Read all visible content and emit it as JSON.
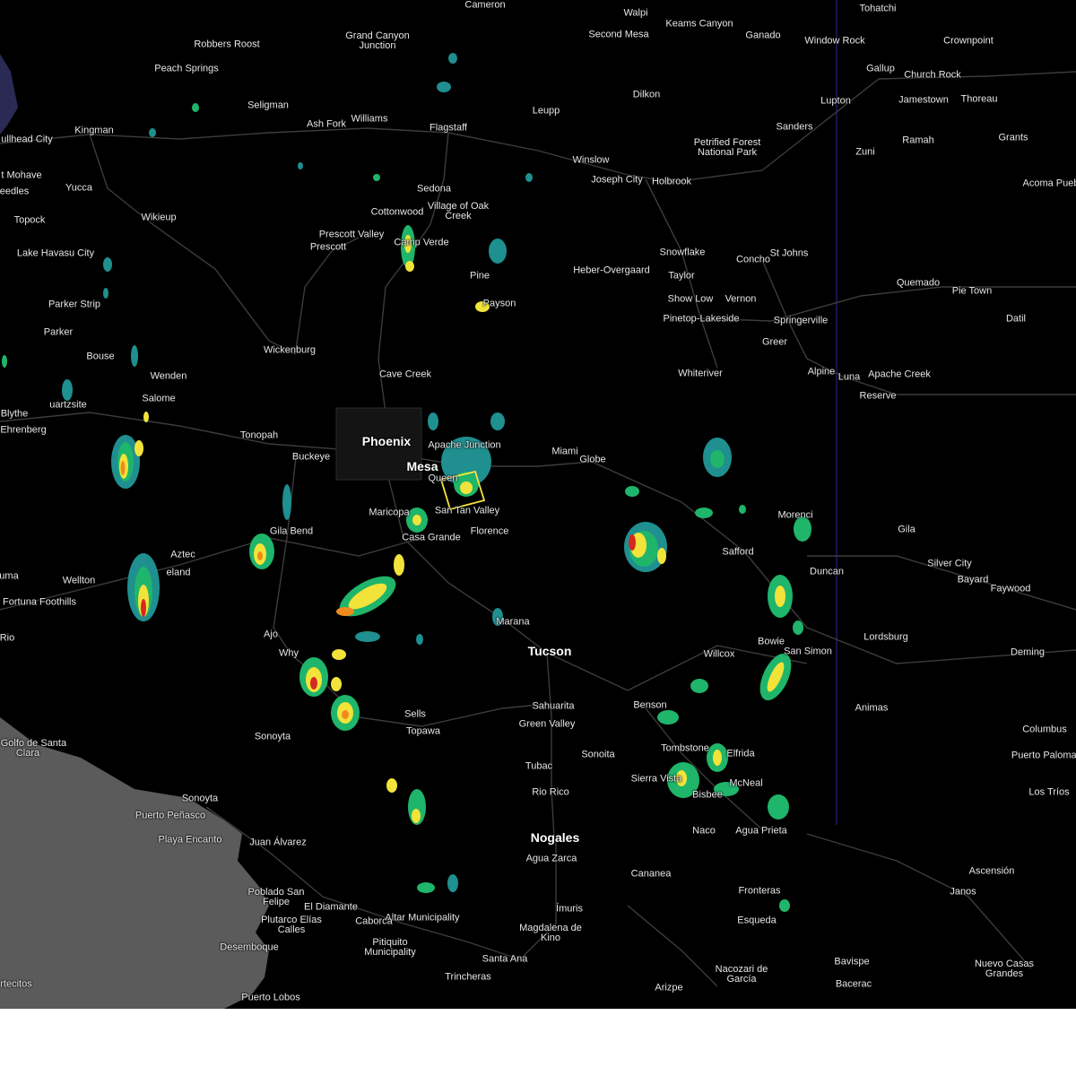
{
  "map": {
    "colors": {
      "background": "#000000",
      "sea": "#5b5b5b",
      "roads": "#3a3a3a",
      "state_line": "#2a2a9a",
      "warning_box": "#f5e53c",
      "radar_light": "#1f8f8f",
      "radar_green": "#1fb56a",
      "radar_yellow": "#f2e33a",
      "radar_orange": "#f08a1e",
      "radar_red": "#d42a1e"
    },
    "labels": [
      {
        "id": "cameron",
        "text": "Cameron"
      },
      {
        "id": "walpi",
        "text": "Walpi"
      },
      {
        "id": "keams-canyon",
        "text": "Keams Canyon"
      },
      {
        "id": "tohatchi",
        "text": "Tohatchi"
      },
      {
        "id": "second-mesa",
        "text": "Second Mesa"
      },
      {
        "id": "ganado",
        "text": "Ganado"
      },
      {
        "id": "window-rock",
        "text": "Window Rock"
      },
      {
        "id": "crownpoint",
        "text": "Crownpoint"
      },
      {
        "id": "robbers-roost",
        "text": "Robbers Roost"
      },
      {
        "id": "grand-canyon-junction",
        "text": "Grand Canyon Junction"
      },
      {
        "id": "peach-springs",
        "text": "Peach Springs"
      },
      {
        "id": "gallup",
        "text": "Gallup"
      },
      {
        "id": "church-rock",
        "text": "Church Rock"
      },
      {
        "id": "dilkon",
        "text": "Dilkon"
      },
      {
        "id": "lupton",
        "text": "Lupton"
      },
      {
        "id": "jamestown",
        "text": "Jamestown"
      },
      {
        "id": "thoreau",
        "text": "Thoreau"
      },
      {
        "id": "seligman",
        "text": "Seligman"
      },
      {
        "id": "leupp",
        "text": "Leupp"
      },
      {
        "id": "ash-fork",
        "text": "Ash Fork"
      },
      {
        "id": "williams",
        "text": "Williams"
      },
      {
        "id": "flagstaff",
        "text": "Flagstaff"
      },
      {
        "id": "kingman",
        "text": "Kingman"
      },
      {
        "id": "sanders",
        "text": "Sanders"
      },
      {
        "id": "bullhead-city",
        "text": "ullhead City"
      },
      {
        "id": "petrified-forest",
        "text": "Petrified Forest National Park"
      },
      {
        "id": "ramah",
        "text": "Ramah"
      },
      {
        "id": "grants",
        "text": "Grants"
      },
      {
        "id": "zuni",
        "text": "Zuni"
      },
      {
        "id": "fort-mohave",
        "text": "t Mohave"
      },
      {
        "id": "winslow",
        "text": "Winslow"
      },
      {
        "id": "needles",
        "text": "eedles"
      },
      {
        "id": "joseph-city",
        "text": "Joseph City"
      },
      {
        "id": "holbrook",
        "text": "Holbrook"
      },
      {
        "id": "acoma-pueblo",
        "text": "Acoma Pueb"
      },
      {
        "id": "yucca",
        "text": "Yucca"
      },
      {
        "id": "sedona",
        "text": "Sedona"
      },
      {
        "id": "village-oak-creek",
        "text": "Village of Oak Creek"
      },
      {
        "id": "topock",
        "text": "Topock"
      },
      {
        "id": "cottonwood",
        "text": "Cottonwood"
      },
      {
        "id": "wikieup",
        "text": "Wikieup"
      },
      {
        "id": "prescott-valley",
        "text": "Prescott Valley"
      },
      {
        "id": "camp-verde",
        "text": "Camp Verde"
      },
      {
        "id": "lake-havasu",
        "text": "Lake Havasu City"
      },
      {
        "id": "prescott",
        "text": "Prescott"
      },
      {
        "id": "snowflake",
        "text": "Snowflake"
      },
      {
        "id": "st-johns",
        "text": "St Johns"
      },
      {
        "id": "concho",
        "text": "Concho"
      },
      {
        "id": "heber",
        "text": "Heber-Overgaard"
      },
      {
        "id": "taylor",
        "text": "Taylor"
      },
      {
        "id": "pine",
        "text": "Pine"
      },
      {
        "id": "quemado",
        "text": "Quemado"
      },
      {
        "id": "pie-town",
        "text": "Pie Town"
      },
      {
        "id": "show-low",
        "text": "Show Low"
      },
      {
        "id": "vernon",
        "text": "Vernon"
      },
      {
        "id": "payson",
        "text": "Payson"
      },
      {
        "id": "parker-strip",
        "text": "Parker Strip"
      },
      {
        "id": "pinetop",
        "text": "Pinetop-Lakeside"
      },
      {
        "id": "springerville",
        "text": "Springerville"
      },
      {
        "id": "datil",
        "text": "Datil"
      },
      {
        "id": "parker",
        "text": "Parker"
      },
      {
        "id": "greer",
        "text": "Greer"
      },
      {
        "id": "wickenburg",
        "text": "Wickenburg"
      },
      {
        "id": "bouse",
        "text": "Bouse"
      },
      {
        "id": "whiteriver",
        "text": "Whiteriver"
      },
      {
        "id": "alpine",
        "text": "Alpine"
      },
      {
        "id": "luna",
        "text": "Luna"
      },
      {
        "id": "apache-creek",
        "text": "Apache Creek"
      },
      {
        "id": "wenden",
        "text": "Wenden"
      },
      {
        "id": "cave-creek",
        "text": "Cave Creek"
      },
      {
        "id": "reserve",
        "text": "Reserve"
      },
      {
        "id": "salome",
        "text": "Salome"
      },
      {
        "id": "quartzsite",
        "text": "uartzsite"
      },
      {
        "id": "blythe",
        "text": "Blythe"
      },
      {
        "id": "ehrenberg",
        "text": "Ehrenberg"
      },
      {
        "id": "tonopah",
        "text": "Tonopah"
      },
      {
        "id": "phoenix",
        "text": "Phoenix",
        "big": true
      },
      {
        "id": "apache-junction",
        "text": "Apache Junction"
      },
      {
        "id": "miami",
        "text": "Miami"
      },
      {
        "id": "globe",
        "text": "Globe"
      },
      {
        "id": "buckeye",
        "text": "Buckeye"
      },
      {
        "id": "mesa",
        "text": "Mesa",
        "big": true
      },
      {
        "id": "queen-creek",
        "text": "Queen"
      },
      {
        "id": "san-tan-valley",
        "text": "San Tan Valley"
      },
      {
        "id": "maricopa",
        "text": "Maricopa"
      },
      {
        "id": "morenci",
        "text": "Morenci"
      },
      {
        "id": "florence",
        "text": "Florence"
      },
      {
        "id": "gila-bend",
        "text": "Gila Bend"
      },
      {
        "id": "casa-grande",
        "text": "Casa Grande"
      },
      {
        "id": "gila",
        "text": "Gila"
      },
      {
        "id": "safford",
        "text": "Safford"
      },
      {
        "id": "aztec",
        "text": "Aztec"
      },
      {
        "id": "dateland",
        "text": "eland"
      },
      {
        "id": "silver-city",
        "text": "Silver City"
      },
      {
        "id": "duncan",
        "text": "Duncan"
      },
      {
        "id": "yuma",
        "text": "uma"
      },
      {
        "id": "wellton",
        "text": "Wellton"
      },
      {
        "id": "bayard",
        "text": "Bayard"
      },
      {
        "id": "faywood",
        "text": "Faywood"
      },
      {
        "id": "fortuna-foothills",
        "text": "Fortuna Foothills"
      },
      {
        "id": "marana",
        "text": "Marana"
      },
      {
        "id": "rio",
        "text": "Rio"
      },
      {
        "id": "ajo",
        "text": "Ajo"
      },
      {
        "id": "lordsburg",
        "text": "Lordsburg"
      },
      {
        "id": "bowie",
        "text": "Bowie"
      },
      {
        "id": "tucson",
        "text": "Tucson",
        "big": true
      },
      {
        "id": "why",
        "text": "Why"
      },
      {
        "id": "willcox",
        "text": "Willcox"
      },
      {
        "id": "san-simon",
        "text": "San Simon"
      },
      {
        "id": "deming",
        "text": "Deming"
      },
      {
        "id": "sahuarita",
        "text": "Sahuarita"
      },
      {
        "id": "benson",
        "text": "Benson"
      },
      {
        "id": "animas",
        "text": "Animas"
      },
      {
        "id": "sells",
        "text": "Sells"
      },
      {
        "id": "green-valley",
        "text": "Green Valley"
      },
      {
        "id": "topawa",
        "text": "Topawa"
      },
      {
        "id": "columbus",
        "text": "Columbus"
      },
      {
        "id": "sonoyta",
        "text": "Sonoyta"
      },
      {
        "id": "golfo",
        "text": "El Golfo de Santa Clara"
      },
      {
        "id": "tombstone",
        "text": "Tombstone"
      },
      {
        "id": "elfrida",
        "text": "Elfrida"
      },
      {
        "id": "puerto-palomas",
        "text": "Puerto Palomas"
      },
      {
        "id": "sonoita",
        "text": "Sonoita"
      },
      {
        "id": "tubac",
        "text": "Tubac"
      },
      {
        "id": "sierra-vista",
        "text": "Sierra Vista"
      },
      {
        "id": "mcneal",
        "text": "McNeal"
      },
      {
        "id": "bisbee",
        "text": "Bisbee"
      },
      {
        "id": "los-trios",
        "text": "Los Tríos"
      },
      {
        "id": "rio-rico",
        "text": "Rio Rico"
      },
      {
        "id": "sonoyta-mx",
        "text": "Sonoyta"
      },
      {
        "id": "puerto-penasco",
        "text": "Puerto Peñasco"
      },
      {
        "id": "naco",
        "text": "Naco"
      },
      {
        "id": "agua-prieta",
        "text": "Agua Prieta"
      },
      {
        "id": "playa-encanto",
        "text": "Playa Encanto"
      },
      {
        "id": "juan-alvarez",
        "text": "Juan Álvarez"
      },
      {
        "id": "nogales",
        "text": "Nogales",
        "big": true
      },
      {
        "id": "agua-zarca",
        "text": "Agua Zarca"
      },
      {
        "id": "cananea",
        "text": "Cananea"
      },
      {
        "id": "ascension",
        "text": "Ascensión"
      },
      {
        "id": "janos",
        "text": "Janos"
      },
      {
        "id": "fronteras",
        "text": "Fronteras"
      },
      {
        "id": "poblado",
        "text": "Poblado San Felipe"
      },
      {
        "id": "el-diamante",
        "text": "El Diamante"
      },
      {
        "id": "altar",
        "text": "Altar Municipality"
      },
      {
        "id": "imuris",
        "text": "Ímuris"
      },
      {
        "id": "esqueda",
        "text": "Esqueda"
      },
      {
        "id": "caborca",
        "text": "Caborca"
      },
      {
        "id": "plutarco",
        "text": "Plutarco Elías Calles"
      },
      {
        "id": "magdalena",
        "text": "Magdalena de Kino"
      },
      {
        "id": "pitiquito",
        "text": "Pitiquito Municipality"
      },
      {
        "id": "desemboque",
        "text": "Desemboque"
      },
      {
        "id": "santa-ana",
        "text": "Santa Ana"
      },
      {
        "id": "bavispe",
        "text": "Bavispe"
      },
      {
        "id": "nuevo-casas",
        "text": "Nuevo Casas Grandes"
      },
      {
        "id": "nacozari",
        "text": "Nacozari de García"
      },
      {
        "id": "trincheras",
        "text": "Trincheras"
      },
      {
        "id": "arizpe",
        "text": "Arizpe"
      },
      {
        "id": "bacerac",
        "text": "Bacerac"
      },
      {
        "id": "puertecitos",
        "text": "rtecitos"
      },
      {
        "id": "puerto-lobos",
        "text": "Puerto Lobos"
      }
    ]
  }
}
